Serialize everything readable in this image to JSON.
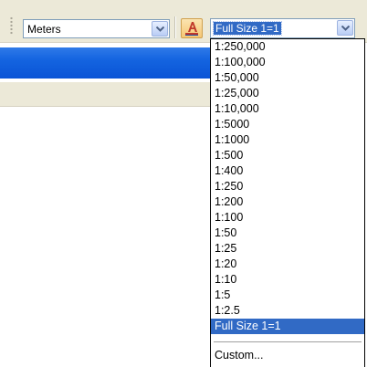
{
  "toolbar": {
    "units_value": "Meters",
    "scale_value": "Full Size 1=1"
  },
  "scale_dropdown": {
    "options": [
      "1:250,000",
      "1:100,000",
      "1:50,000",
      "1:25,000",
      "1:10,000",
      "1:5000",
      "1:1000",
      "1:500",
      "1:400",
      "1:250",
      "1:200",
      "1:100",
      "1:50",
      "1:25",
      "1:20",
      "1:10",
      "1:5",
      "1:2.5",
      "Full Size 1=1"
    ],
    "selected_index": 18,
    "custom_label": "Custom..."
  },
  "colors": {
    "selection": "#316ac5",
    "toolbar_bg": "#ece9d8",
    "title_band": "#1464e0"
  },
  "icons": {
    "dropdown": "chevron-down-icon",
    "annotation_style": "annotation-style-icon"
  }
}
